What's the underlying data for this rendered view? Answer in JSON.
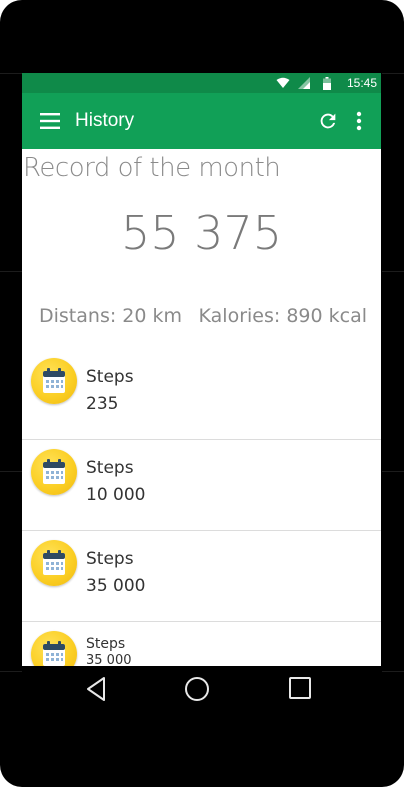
{
  "status_bar": {
    "time": "15:45",
    "icons": [
      "wifi-icon",
      "signal-icon",
      "battery-icon"
    ]
  },
  "app_bar": {
    "title": "History",
    "icons": [
      "menu-icon",
      "refresh-icon",
      "more-vert-icon"
    ]
  },
  "record": {
    "title": "Record of the month",
    "value": "55 375",
    "distance": "Distans: 20 km",
    "calories": "Kalories: 890 kcal"
  },
  "history": {
    "items": [
      {
        "label": "Steps",
        "value": "235"
      },
      {
        "label": "Steps",
        "value": "10 000"
      },
      {
        "label": "Steps",
        "value": "35 000"
      },
      {
        "label": "Steps",
        "value": "35 000"
      }
    ]
  },
  "navigation": {
    "buttons": [
      "back-icon",
      "home-icon",
      "recents-icon"
    ]
  },
  "colors": {
    "status_bar": "#0f8a49",
    "app_bar": "#11a057",
    "badge": "#fbcf25"
  }
}
